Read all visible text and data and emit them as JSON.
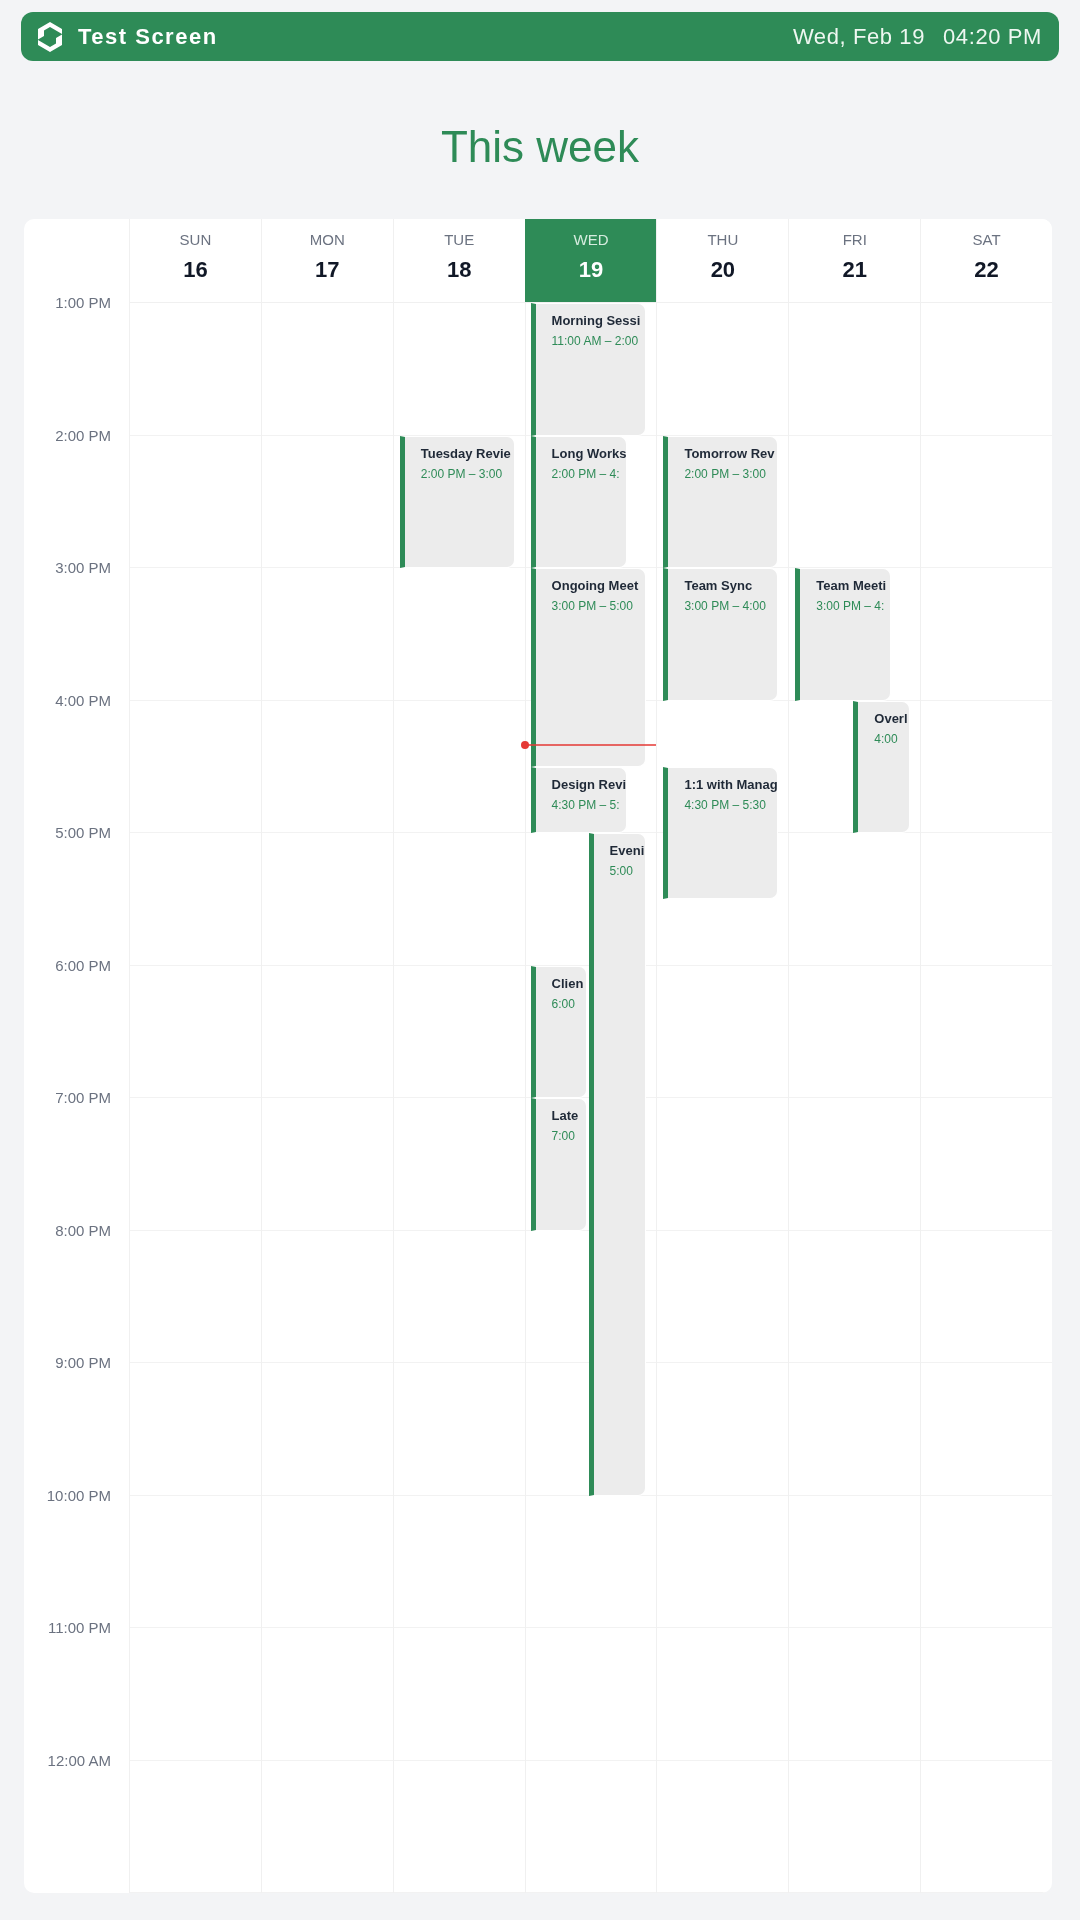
{
  "header": {
    "title": "Test Screen",
    "date": "Wed, Feb 19",
    "time": "04:20 PM"
  },
  "heading": "This week",
  "calendar": {
    "time_labels": [
      "1:00 PM",
      "2:00 PM",
      "3:00 PM",
      "4:00 PM",
      "5:00 PM",
      "6:00 PM",
      "7:00 PM",
      "8:00 PM",
      "9:00 PM",
      "10:00 PM",
      "11:00 PM",
      "12:00 AM"
    ],
    "days": [
      {
        "name": "SUN",
        "date": "16",
        "selected": false
      },
      {
        "name": "MON",
        "date": "17",
        "selected": false
      },
      {
        "name": "TUE",
        "date": "18",
        "selected": false,
        "events": [
          {
            "title": "Tuesday Revie",
            "time": "2:00 PM – 3:00"
          }
        ]
      },
      {
        "name": "WED",
        "date": "19",
        "selected": true,
        "events": [
          {
            "title": "Morning Sessi",
            "time": "11:00 AM – 2:00"
          },
          {
            "title": "Long Works",
            "time": "2:00 PM – 4:"
          },
          {
            "title": "Ongoing Meet",
            "time": "3:00 PM – 5:00"
          },
          {
            "title": "Design Revi",
            "time": "4:30 PM – 5:"
          },
          {
            "title": "Eveni",
            "time": "5:00"
          },
          {
            "title": "Clien",
            "time": "6:00"
          },
          {
            "title": "Late",
            "time": "7:00"
          }
        ]
      },
      {
        "name": "THU",
        "date": "20",
        "selected": false,
        "events": [
          {
            "title": "Tomorrow Rev",
            "time": "2:00 PM – 3:00"
          },
          {
            "title": "Team Sync",
            "time": "3:00 PM – 4:00"
          },
          {
            "title": "1:1 with Manag",
            "time": "4:30 PM – 5:30"
          }
        ]
      },
      {
        "name": "FRI",
        "date": "21",
        "selected": false,
        "events": [
          {
            "title": "Team Meeti",
            "time": "3:00 PM – 4:"
          },
          {
            "title": "Overl",
            "time": "4:00"
          }
        ]
      },
      {
        "name": "SAT",
        "date": "22",
        "selected": false
      }
    ]
  }
}
